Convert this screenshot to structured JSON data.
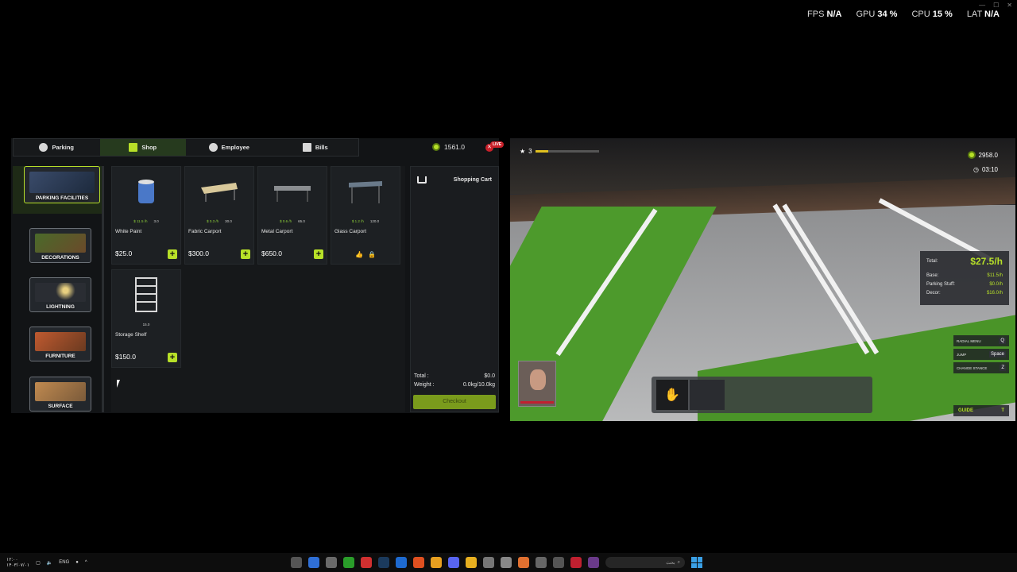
{
  "stats": {
    "fps_label": "FPS",
    "fps_value": "N/A",
    "gpu_label": "GPU",
    "gpu_value": "34 %",
    "cpu_label": "CPU",
    "cpu_value": "15 %",
    "lat_label": "LAT",
    "lat_value": "N/A"
  },
  "tabs": [
    {
      "label": "Parking",
      "icon": "parking-icon"
    },
    {
      "label": "Shop",
      "icon": "cart-icon"
    },
    {
      "label": "Employee",
      "icon": "person-icon"
    },
    {
      "label": "Bills",
      "icon": "document-icon"
    }
  ],
  "wallet": {
    "value": "1561.0",
    "live": "LIVE"
  },
  "categories": [
    {
      "label": "PARKING FACILITIES",
      "active": true
    },
    {
      "label": "DECORATIONS"
    },
    {
      "label": "LIGHTNING"
    },
    {
      "label": "FURNITURE"
    },
    {
      "label": "SURFACE"
    }
  ],
  "items": [
    {
      "name": "White Paint",
      "stat1": "$ 11.5 /h",
      "stat2": "3.0",
      "price": "$25.0",
      "add": "+"
    },
    {
      "name": "Fabric Carport",
      "stat1": "$ 0.3 /h",
      "stat2": "30.0",
      "price": "$300.0",
      "add": "+"
    },
    {
      "name": "Metal Carport",
      "stat1": "$ 0.6 /h",
      "stat2": "65.0",
      "price": "$650.0",
      "add": "+"
    },
    {
      "name": "Glass Carport",
      "stat1": "$ 1.2 /h",
      "stat2": "120.0",
      "price": "",
      "locked": true
    },
    {
      "name": "Storage Shelf",
      "stat1": "",
      "stat2": "15.0",
      "price": "$150.0",
      "add": "+"
    }
  ],
  "cart": {
    "title": "Shopping Cart",
    "total_label": "Total :",
    "total_value": "$0.0",
    "weight_label": "Weight :",
    "weight_value": "0.0kg/10.0kg",
    "checkout": "Checkout"
  },
  "game": {
    "level": "3",
    "level_progress": 0.2,
    "money": "2958.0",
    "live": "LIVE",
    "time": "03:10",
    "income": {
      "total_label": "Total:",
      "total_value": "$27.5/h",
      "rows": [
        {
          "label": "Base:",
          "value": "$11.5/h"
        },
        {
          "label": "Parking Stuff:",
          "value": "$0.0/h"
        },
        {
          "label": "Decor:",
          "value": "$16.0/h"
        }
      ]
    },
    "keys": [
      {
        "label": "RADIAL MENU",
        "key": "Q"
      },
      {
        "label": "JUMP",
        "key": "Space"
      },
      {
        "label": "CHANGE STANCE",
        "key": "Z"
      }
    ],
    "guide": {
      "label": "GUIDE",
      "key": "T"
    }
  },
  "taskbar": {
    "time": "۱۲:۰۰",
    "date": "۱۴۰۳/۰۷/۰۱",
    "lang": "ENG",
    "search": "بحث"
  },
  "colors": {
    "accent": "#b7e028",
    "live": "#c9202a"
  }
}
